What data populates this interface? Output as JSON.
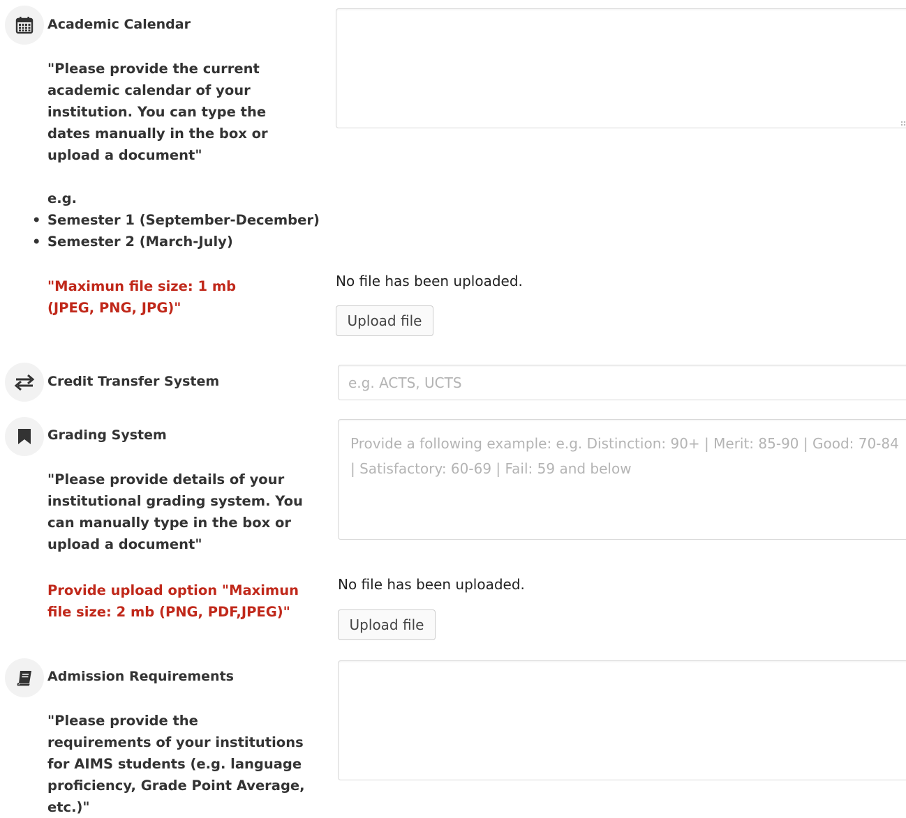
{
  "sections": {
    "academic_calendar": {
      "title": "Academic Calendar",
      "icon": "calendar-icon",
      "description": "\"Please provide the current academic calendar of your institution. You can type the dates manually in the box or upload a document\"",
      "example_label": "e.g.",
      "examples": [
        "Semester 1 (September-December)",
        "Semester 2 (March-July)"
      ],
      "file_note": "\"Maximun file size: 1 mb (JPEG, PNG, JPG)\"",
      "textarea_value": "",
      "upload_status": "No file has been uploaded.",
      "upload_label": "Upload file"
    },
    "credit_transfer": {
      "title": "Credit Transfer System",
      "icon": "transfer-arrows-icon",
      "placeholder": "e.g. ACTS, UCTS"
    },
    "grading_system": {
      "title": "Grading System",
      "icon": "bookmark-icon",
      "placeholder_line1": "Provide a following example:  e.g. Distinction: 90+ | Merit: 85-90 | Good: 70-84",
      "placeholder_line2": "| Satisfactory: 60-69 | Fail: 59 and below",
      "description": "\"Please provide details of your institutional grading system. You can manually type in the box or upload a document\"",
      "file_note": "Provide upload option \"Maximun file size: 2 mb (PNG, PDF,JPEG)\"",
      "upload_status": "No file has been uploaded.",
      "upload_label": "Upload file"
    },
    "admission_requirements": {
      "title": "Admission Requirements",
      "icon": "book-icon",
      "description": "\"Please provide the requirements of your institutions for AIMS students (e.g. language proficiency, Grade Point Average, etc.)\"",
      "textarea_value": ""
    }
  },
  "colors": {
    "note_red": "#c0281a",
    "icon_bg": "#f2f2f2",
    "icon_fg": "#333333",
    "placeholder": "#b4b4b4"
  }
}
